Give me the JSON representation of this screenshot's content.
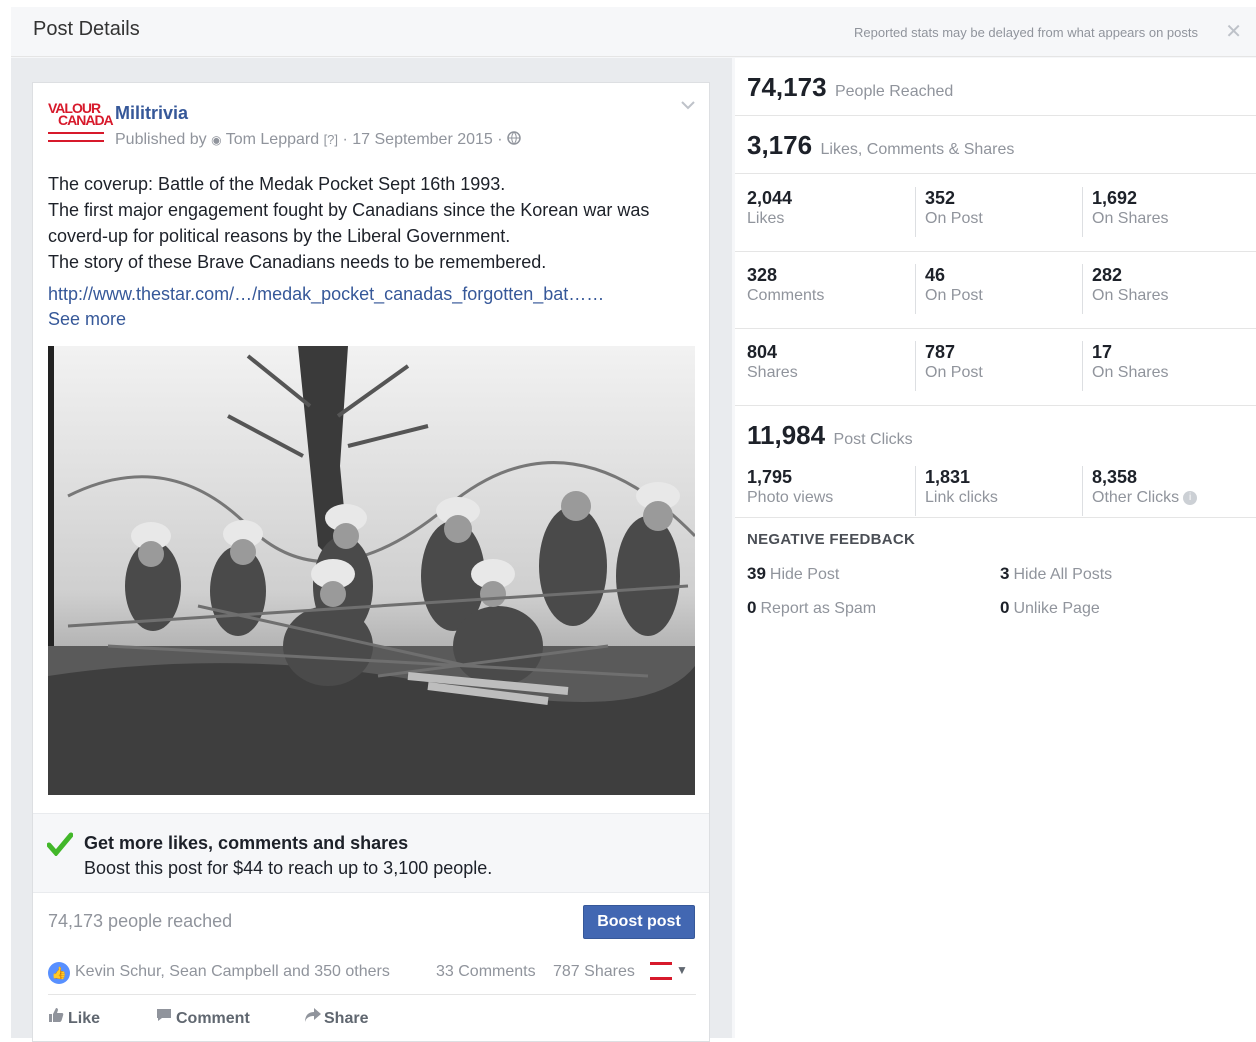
{
  "dialog": {
    "title": "Post Details",
    "note": "Reported stats may be delayed from what appears on posts",
    "close_glyph": "✕"
  },
  "post": {
    "logo_text_1": "VALOUR",
    "logo_text_2": "CANADA",
    "page_name": "Militrivia",
    "published_by": "Published by",
    "author": "Tom Leppard",
    "help_marker": "[?]",
    "date": "17 September 2015",
    "body_lines": [
      "The coverup: Battle of the Medak Pocket Sept 16th 1993.",
      "The first major engagement fought by Canadians since the Korean war was",
      "coverd-up for political reasons by the Liberal Government.",
      "The story of these Brave Canadians needs to be remembered."
    ],
    "link": "http://www.thestar.com/…/medak_pocket_canadas_forgotten_bat……",
    "see_more": "See more",
    "boost_heading": "Get more likes, comments and shares",
    "boost_sub": "Boost this post for $44 to reach up to 3,100 people.",
    "people_reached": "74,173 people reached",
    "boost_button": "Boost post",
    "reactions_names": "Kevin Schur, Sean Campbell and 350 others",
    "comments_count": "33 Comments",
    "shares_count": "787 Shares",
    "actions": {
      "like": "Like",
      "comment": "Comment",
      "share": "Share"
    },
    "icons": {
      "globe": "globe-icon",
      "chevron": "chevron-down-icon",
      "check": "checkmark-icon",
      "like_bubble": "like-reaction-icon",
      "like": "thumbs-up-icon",
      "comment": "comment-icon",
      "share": "share-arrow-icon"
    }
  },
  "stats": {
    "reached": {
      "value": "74,173",
      "label": "People Reached"
    },
    "engagement": {
      "value": "3,176",
      "label": "Likes, Comments & Shares"
    },
    "likes": {
      "total": "2,044",
      "total_label": "Likes",
      "on_post": "352",
      "on_post_label": "On Post",
      "on_shares": "1,692",
      "on_shares_label": "On Shares"
    },
    "comments": {
      "total": "328",
      "total_label": "Comments",
      "on_post": "46",
      "on_post_label": "On Post",
      "on_shares": "282",
      "on_shares_label": "On Shares"
    },
    "shares": {
      "total": "804",
      "total_label": "Shares",
      "on_post": "787",
      "on_post_label": "On Post",
      "on_shares": "17",
      "on_shares_label": "On Shares"
    },
    "clicks": {
      "value": "11,984",
      "label": "Post Clicks"
    },
    "click_breakdown": {
      "photo": "1,795",
      "photo_label": "Photo views",
      "link": "1,831",
      "link_label": "Link clicks",
      "other": "8,358",
      "other_label": "Other Clicks"
    },
    "negative": {
      "title": "NEGATIVE FEEDBACK",
      "hide_post": "39",
      "hide_post_label": "Hide Post",
      "hide_all": "3",
      "hide_all_label": "Hide All Posts",
      "spam": "0",
      "spam_label": "Report as Spam",
      "unlike": "0",
      "unlike_label": "Unlike Page"
    }
  },
  "colors": {
    "link": "#365899",
    "boost_button": "#4267b2",
    "brand_red": "#d7192b",
    "check_green": "#42b72a",
    "muted": "#90949c"
  }
}
